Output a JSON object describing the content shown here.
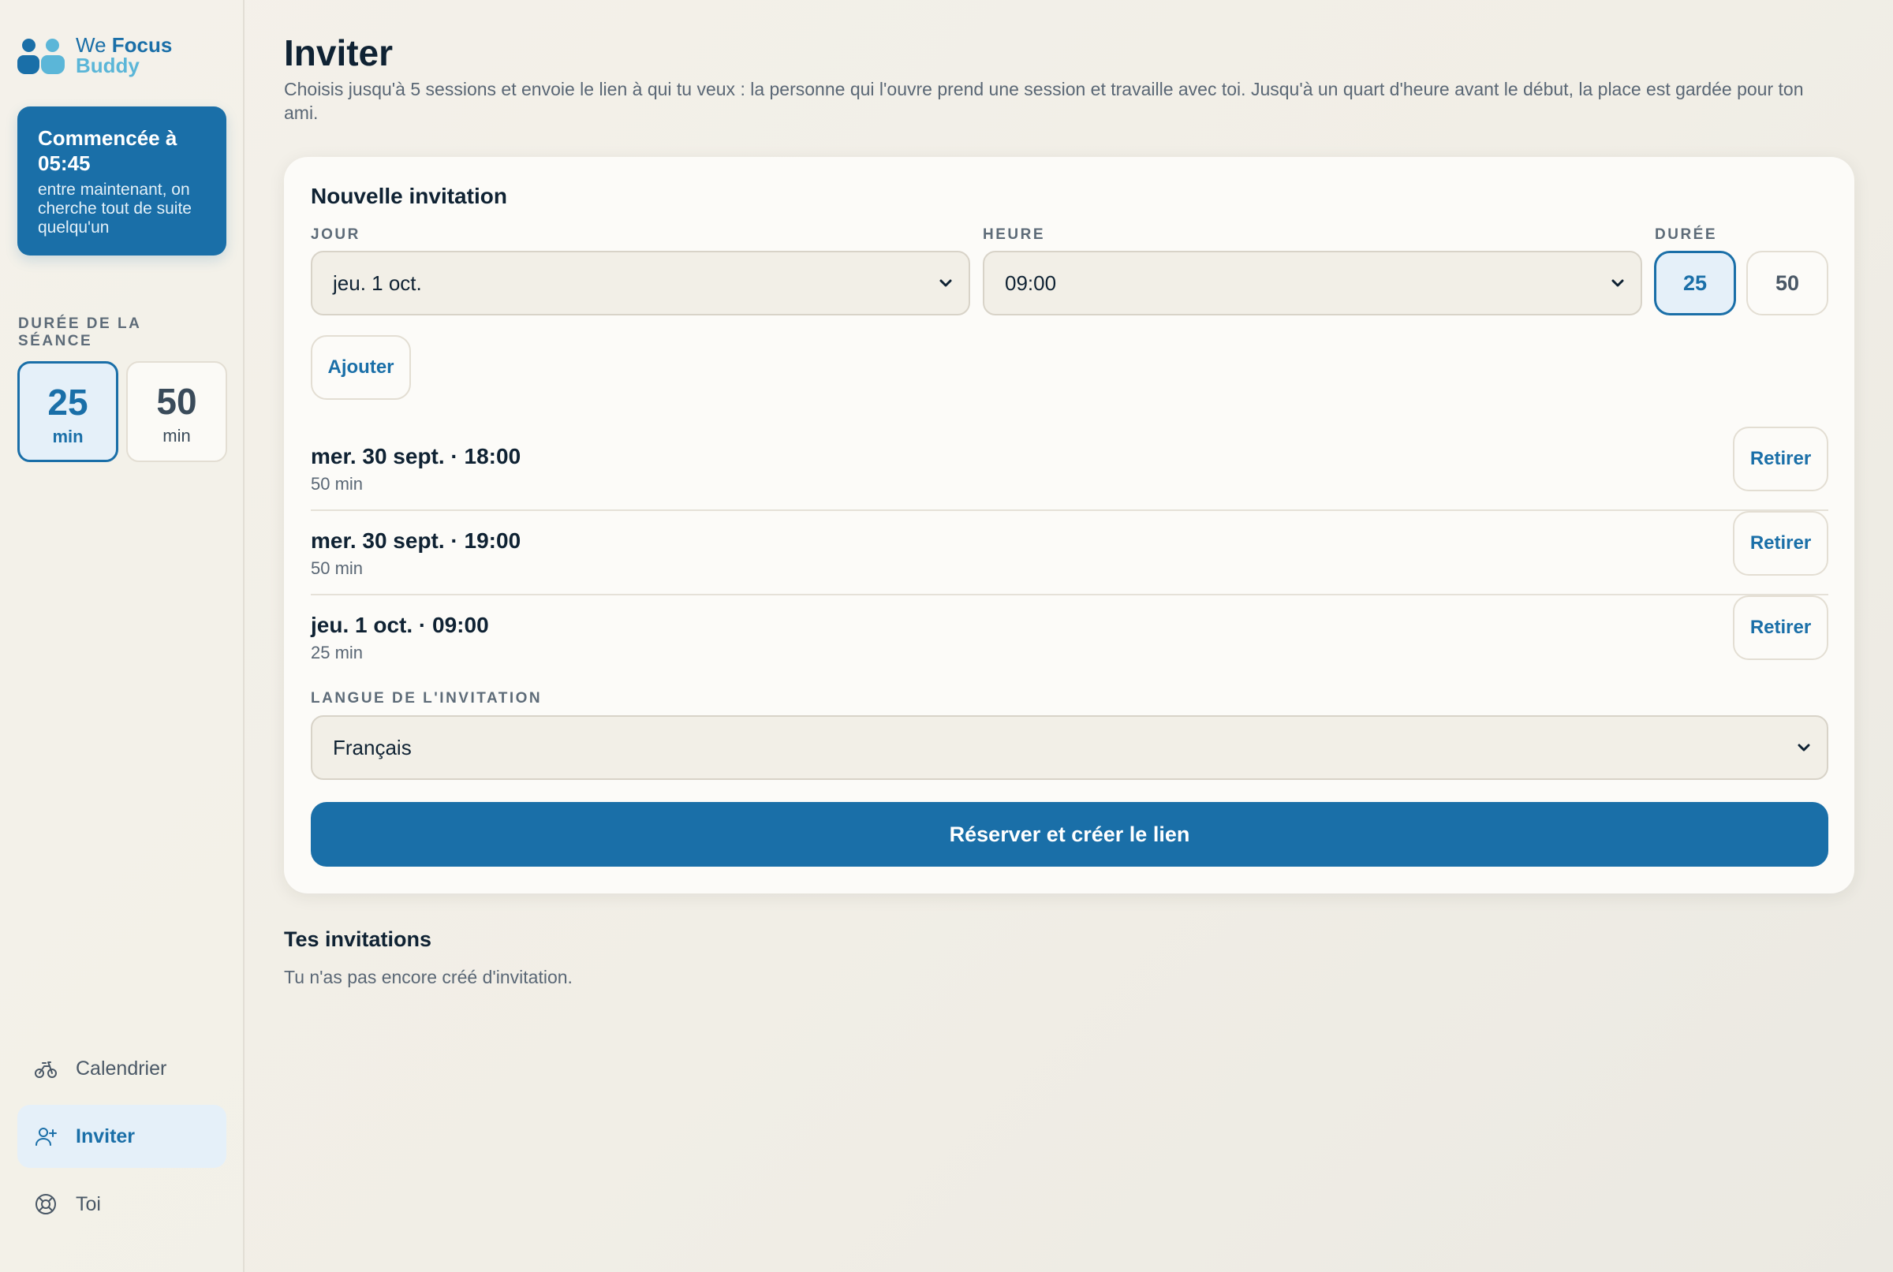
{
  "brand": {
    "we": "We",
    "focus": "Focus",
    "buddy": "Buddy"
  },
  "status": {
    "title": "Commencée à 05:45",
    "subtitle": "entre maintenant, on cherche tout de suite quelqu'un"
  },
  "sidebar": {
    "duration_label": "DURÉE DE LA SÉANCE",
    "durations": [
      {
        "value": "25",
        "unit": "min",
        "selected": true
      },
      {
        "value": "50",
        "unit": "min",
        "selected": false
      }
    ],
    "nav": [
      {
        "label": "Calendrier",
        "icon": "bike-icon",
        "active": false
      },
      {
        "label": "Inviter",
        "icon": "user-plus-icon",
        "active": true
      },
      {
        "label": "Toi",
        "icon": "lifebuoy-icon",
        "active": false
      }
    ]
  },
  "page": {
    "title": "Inviter",
    "description": "Choisis jusqu'à 5 sessions et envoie le lien à qui tu veux : la personne qui l'ouvre prend une session et travaille avec toi. Jusqu'à un quart d'heure avant le début, la place est gardée pour ton ami."
  },
  "form": {
    "title": "Nouvelle invitation",
    "day_label": "JOUR",
    "day_value": "jeu. 1 oct.",
    "hour_label": "HEURE",
    "hour_value": "09:00",
    "duration_label": "DURÉE",
    "duration_options": [
      "25",
      "50"
    ],
    "duration_selected": "25",
    "add_label": "Ajouter",
    "sessions": [
      {
        "when": "mer. 30 sept. · 18:00",
        "length": "50 min",
        "remove": "Retirer"
      },
      {
        "when": "mer. 30 sept. · 19:00",
        "length": "50 min",
        "remove": "Retirer"
      },
      {
        "when": "jeu. 1 oct. · 09:00",
        "length": "25 min",
        "remove": "Retirer"
      }
    ],
    "language_label": "LANGUE DE L'INVITATION",
    "language_value": "Français",
    "submit_label": "Réserver et créer le lien"
  },
  "invitations": {
    "title": "Tes invitations",
    "empty": "Tu n'as pas encore créé d'invitation."
  },
  "colors": {
    "accent": "#1a6fa8",
    "accent_light": "#5bb6d8",
    "selected_bg": "#e5f0f9"
  }
}
